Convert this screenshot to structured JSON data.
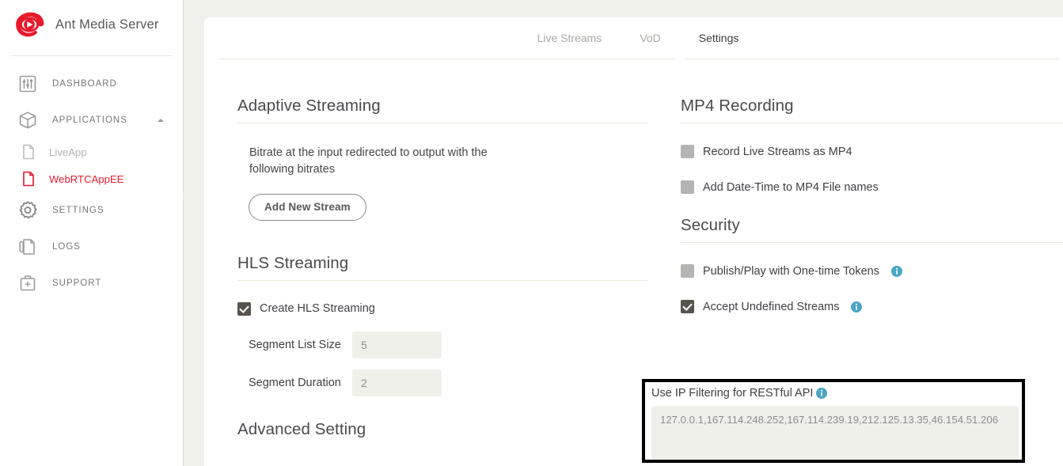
{
  "brand": {
    "name": "Ant Media Server",
    "logo_icon": "ant-media-eye-logo",
    "accent_color": "#e8192c"
  },
  "sidebar": {
    "items": [
      {
        "label": "DASHBOARD",
        "icon": "sliders-icon",
        "type": "nav"
      },
      {
        "label": "APPLICATIONS",
        "icon": "box-icon",
        "type": "nav",
        "expanded": true,
        "caret": "chevron-up-icon"
      },
      {
        "label": "LiveApp",
        "icon": "file-icon",
        "type": "sub",
        "state": "inactive"
      },
      {
        "label": "WebRTCAppEE",
        "icon": "file-icon",
        "type": "sub",
        "state": "active"
      },
      {
        "label": "SETTINGS",
        "icon": "gear-icon",
        "type": "nav"
      },
      {
        "label": "LOGS",
        "icon": "document-pen-icon",
        "type": "nav"
      },
      {
        "label": "SUPPORT",
        "icon": "briefcase-plus-icon",
        "type": "nav"
      }
    ]
  },
  "tabs": [
    {
      "label": "Live Streams",
      "active": false
    },
    {
      "label": "VoD",
      "active": false
    },
    {
      "label": "Settings",
      "active": true
    }
  ],
  "left_column": {
    "adaptive_streaming": {
      "title": "Adaptive Streaming",
      "description": "Bitrate at the input redirected to output with the following bitrates",
      "add_button": "Add New Stream"
    },
    "hls_streaming": {
      "title": "HLS Streaming",
      "create_hls_label": "Create HLS Streaming",
      "create_hls_checked": true,
      "segment_list_size_label": "Segment List Size",
      "segment_list_size_value": "5",
      "segment_duration_label": "Segment Duration",
      "segment_duration_value": "2"
    },
    "advanced_setting": {
      "title": "Advanced Setting"
    }
  },
  "right_column": {
    "mp4_recording": {
      "title": "MP4 Recording",
      "options": [
        {
          "label": "Record Live Streams as MP4",
          "checked": false
        },
        {
          "label": "Add Date-Time to MP4 File names",
          "checked": false
        }
      ]
    },
    "security": {
      "title": "Security",
      "options": [
        {
          "label": "Publish/Play with One-time Tokens",
          "checked": false,
          "info": "info-icon"
        },
        {
          "label": "Accept Undefined Streams",
          "checked": true,
          "info": "info-icon"
        }
      ],
      "ip_filtering": {
        "label": "Use IP Filtering for RESTful API",
        "info": "info-icon",
        "value": "127.0.0.1,167.114.248.252,167.114.239.19,212.125.13.35,46.154.51.206",
        "highlighted": true,
        "highlight_color": "#000000"
      }
    }
  },
  "colors": {
    "page_background": "#f1f1ec",
    "card_background": "#ffffff",
    "info_blue": "#4aa5c6",
    "checkbox_checked": "#57534d",
    "checkbox_unchecked": "#b4b4b2",
    "rule": "#eee7dd"
  }
}
